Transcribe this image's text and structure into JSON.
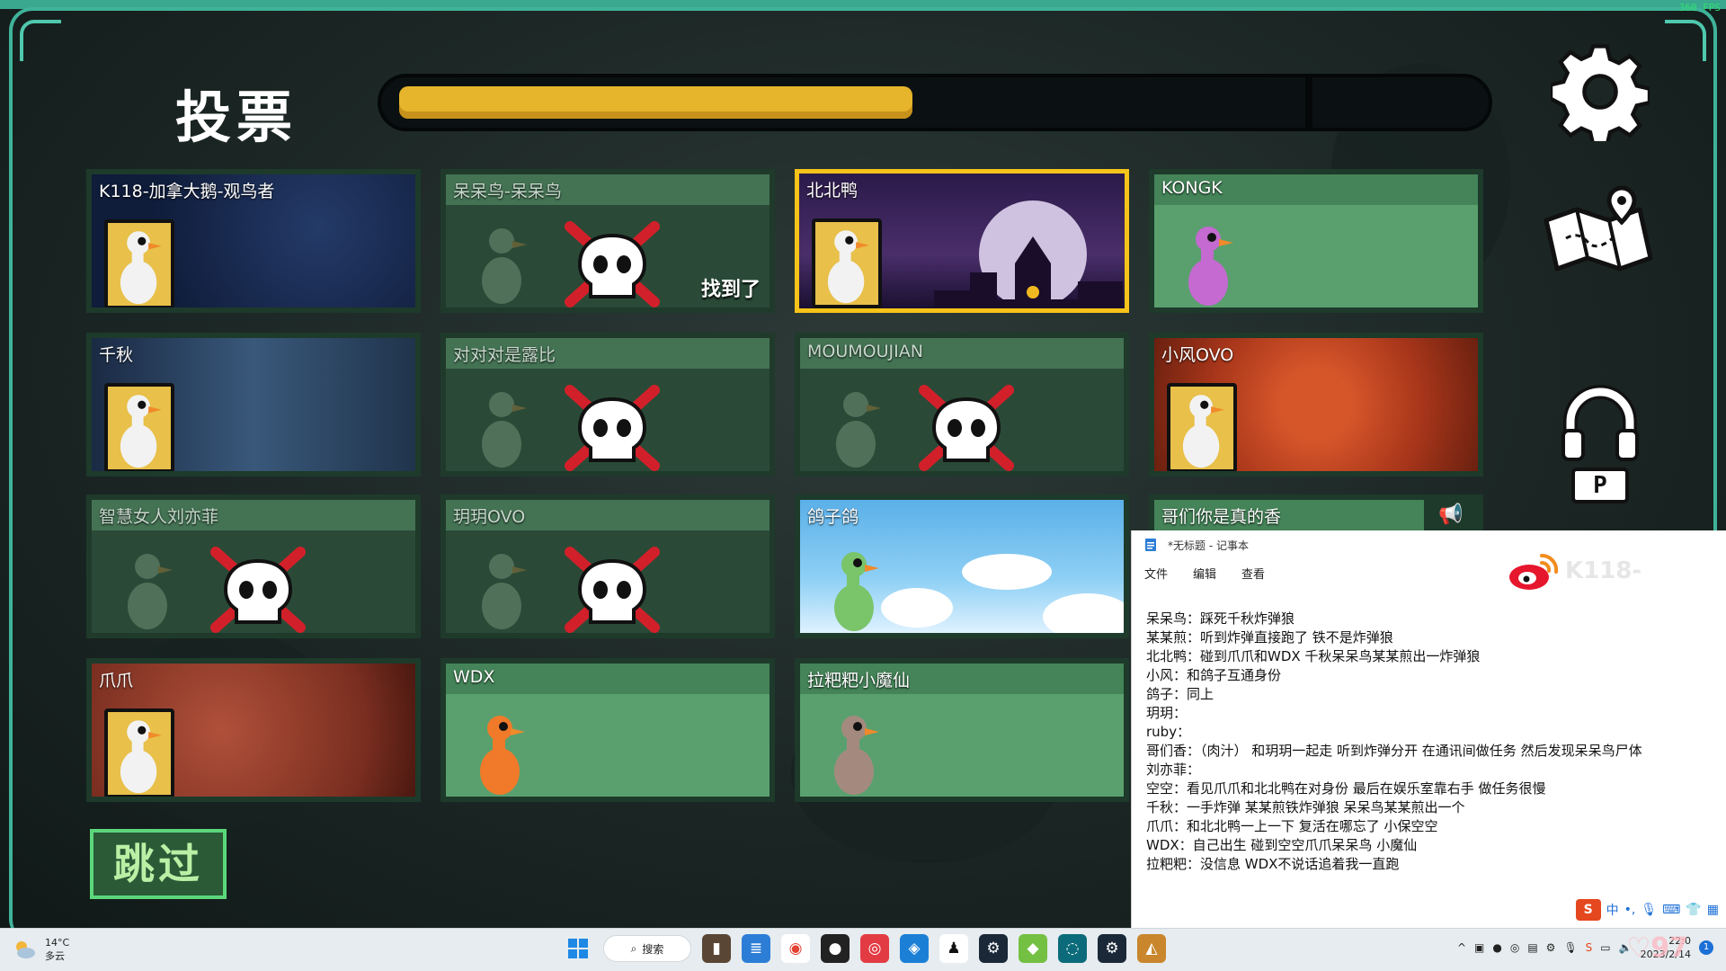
{
  "game": {
    "title": "投票",
    "fps": "360 FPS",
    "vote_progress": 0.48,
    "skip_label": "跳过",
    "push_to_talk_key": "P",
    "found_label": "找到了",
    "players": [
      {
        "name": "K118-加拿大鹅-观鸟者",
        "status": "alive",
        "bg": "space"
      },
      {
        "name": "呆呆鸟-呆呆鸟",
        "status": "dead",
        "found": true
      },
      {
        "name": "北北鸭",
        "status": "alive",
        "highlighted": true,
        "bg": "night"
      },
      {
        "name": "KONGK",
        "status": "alive",
        "bg": "plain"
      },
      {
        "name": "千秋",
        "status": "alive",
        "bg": "geese"
      },
      {
        "name": "对对对是露比",
        "status": "dead"
      },
      {
        "name": "MOUMOUJIAN",
        "status": "dead"
      },
      {
        "name": "小风OVO",
        "status": "alive",
        "bg": "meat"
      },
      {
        "name": "智慧女人刘亦菲",
        "status": "dead"
      },
      {
        "name": "玥玥OVO",
        "status": "dead"
      },
      {
        "name": "鸽子鸽",
        "status": "alive",
        "bg": "sky"
      },
      {
        "name": "哥们你是真的香",
        "status": "alive",
        "bg": "plain"
      },
      {
        "name": "爪爪",
        "status": "alive",
        "bg": "rust"
      },
      {
        "name": "WDX",
        "status": "alive",
        "bg": "plain"
      },
      {
        "name": "拉粑粑小魔仙",
        "status": "alive",
        "bg": "plain"
      }
    ]
  },
  "notepad": {
    "title": "*无标题 - 记事本",
    "menu": [
      "文件",
      "编辑",
      "查看"
    ],
    "watermark": "K118-",
    "lines": [
      "呆呆鸟：踩死千秋炸弹狼",
      "某某煎：听到炸弹直接跑了 铁不是炸弹狼",
      "北北鸭：碰到爪爪和WDX 千秋呆呆鸟某某煎出一炸弹狼",
      "小风：和鸽子互通身份",
      "鸽子：同上",
      "玥玥：",
      "ruby：",
      "哥们香：（肉汁） 和玥玥一起走 听到炸弹分开 在通讯间做任务 然后发现呆呆鸟尸体",
      "刘亦菲：",
      "空空：看见爪爪和北北鸭在对身份 最后在娱乐室靠右手 做任务很慢",
      "千秋：一手炸弹 某某煎铁炸弹狼 呆呆鸟某某煎出一个",
      "爪爪：和北北鸭一上一下 复活在哪忘了 小保空空",
      "WDX：自己出生 碰到空空爪爪呆呆鸟 小魔仙",
      "拉粑粑：没信息 WDX不说话追着我一直跑"
    ],
    "ime": "中"
  },
  "taskbar": {
    "temp": "14°C",
    "condition": "多云",
    "search": "搜索",
    "time": "22:0",
    "date": "2023/2/14",
    "notif": "1",
    "overlay_number": "97"
  }
}
